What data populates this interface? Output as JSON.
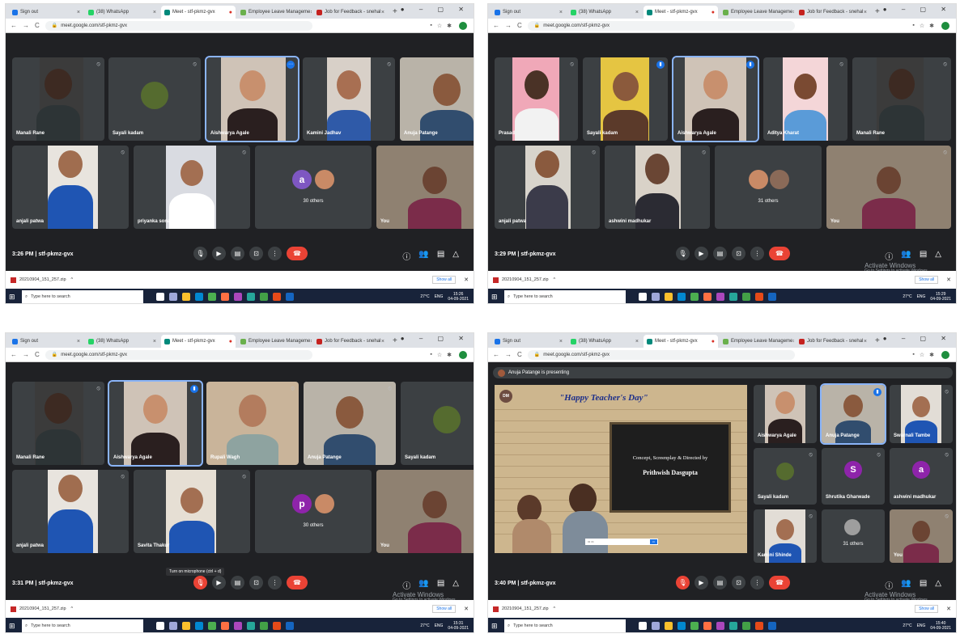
{
  "browser": {
    "tabs": [
      "Sign out",
      "(38) WhatsApp",
      "Meet - stf-pkmz-gvx",
      "Employee Leave Manageme",
      "Job for Feedback - snehal"
    ],
    "url": "meet.google.com/stf-pkmz-gvx"
  },
  "screens": [
    {
      "time": "3:26 PM",
      "meeting": "stf-pkmz-gvx",
      "tiles": [
        "Manali Rane",
        "Sayali kadam",
        "Aishwarya Agale",
        "Kamini Jadhav",
        "Anuja Patange",
        "anjali patwa",
        "priyanka sonar",
        "",
        "You"
      ],
      "others": "30 others",
      "others_avatar_letter": "a",
      "clock": [
        "15:26",
        "04-09-2021"
      ]
    },
    {
      "time": "3:29 PM",
      "meeting": "stf-pkmz-gvx",
      "tiles": [
        "Prasad",
        "Sayali kadam",
        "Aishwarya Agale",
        "Aditya Kharat",
        "Manali Rane",
        "anjali patwa",
        "ashwini madhukar",
        "",
        "You"
      ],
      "others": "31 others",
      "clock": [
        "15:29",
        "04-09-2021"
      ]
    },
    {
      "time": "3:31 PM",
      "meeting": "stf-pkmz-gvx",
      "tiles": [
        "Manali Rane",
        "Aishwarya Agale",
        "Rupali Wagh",
        "Anuja Patange",
        "Sayali kadam",
        "anjali patwa",
        "Savita Thakur",
        "",
        "You"
      ],
      "others": "30 others",
      "others_avatar_letter": "p",
      "tooltip": "Turn on microphone (ctrl + d)",
      "clock": [
        "15:31",
        "04-09-2021"
      ]
    },
    {
      "time": "3:40 PM",
      "meeting": "stf-pkmz-gvx",
      "presenting": "Anuja Patange is presenting",
      "slide_title": "\"Happy Teacher's Day\"",
      "slide_line1": "Concept, Screenplay & Directed by",
      "slide_line2": "Prithwish Dasgupta",
      "tiles": [
        "Aishwarya Agale",
        "Anuja Patange",
        "Swarnali Tambe",
        "Sayali kadam",
        "Shrutika Gharwade",
        "ashwini madhukar",
        "Kamini Shinde",
        "",
        "You"
      ],
      "avatar_letters": [
        "S",
        "a"
      ],
      "others": "31 others",
      "clock": [
        "15:40",
        "04-09-2021"
      ]
    }
  ],
  "download": {
    "file": "20210904_151_257.zip",
    "show_all": "Show all"
  },
  "taskbar": {
    "search_placeholder": "Type here to search",
    "weather": "27°C",
    "lang": "ENG"
  },
  "watermark": {
    "title": "Activate Windows",
    "sub": "Go to Settings to activate Windows."
  }
}
